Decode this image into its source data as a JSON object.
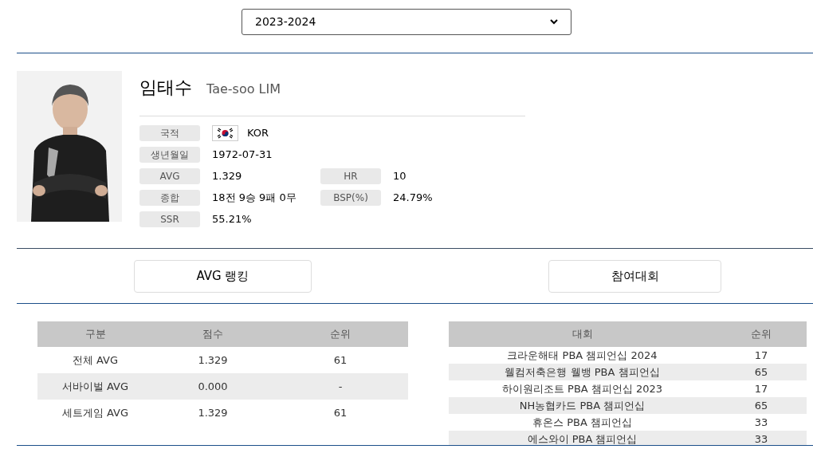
{
  "season_select": {
    "value": "2023-2024"
  },
  "player": {
    "name_ko": "임태수",
    "name_en": "Tae-soo LIM",
    "info": [
      {
        "label": "국적",
        "value": "KOR",
        "flag": true
      },
      {
        "label": "생년월일",
        "value": "1972-07-31"
      },
      {
        "label": "AVG",
        "value": "1.329",
        "extra_label": "HR",
        "extra_value": "10"
      },
      {
        "label": "종합",
        "value": "18전 9승 9패 0무",
        "extra_label": "BSP(%)",
        "extra_value": "24.79%"
      },
      {
        "label": "SSR",
        "value": "55.21%"
      }
    ]
  },
  "section_buttons": [
    "AVG 랭킹",
    "참여대회"
  ],
  "ranking_table": {
    "columns": [
      "구분",
      "점수",
      "순위"
    ],
    "rows": [
      [
        "전체 AVG",
        "1.329",
        "61"
      ],
      [
        "서바이벌 AVG",
        "0.000",
        "-"
      ],
      [
        "세트게임 AVG",
        "1.329",
        "61"
      ]
    ]
  },
  "events_table": {
    "columns": [
      "대회",
      "순위"
    ],
    "rows": [
      [
        "크라운해태 PBA 챔피언십 2024",
        "17"
      ],
      [
        "웰컴저축은행 웰뱅 PBA 챔피언십",
        "65"
      ],
      [
        "하이원리조트 PBA 챔피언십 2023",
        "17"
      ],
      [
        "NH농협카드 PBA 챔피언십",
        "65"
      ],
      [
        "휴온스 PBA 챔피언십",
        "33"
      ],
      [
        "에스와이 PBA 챔피언십",
        "33"
      ]
    ]
  }
}
